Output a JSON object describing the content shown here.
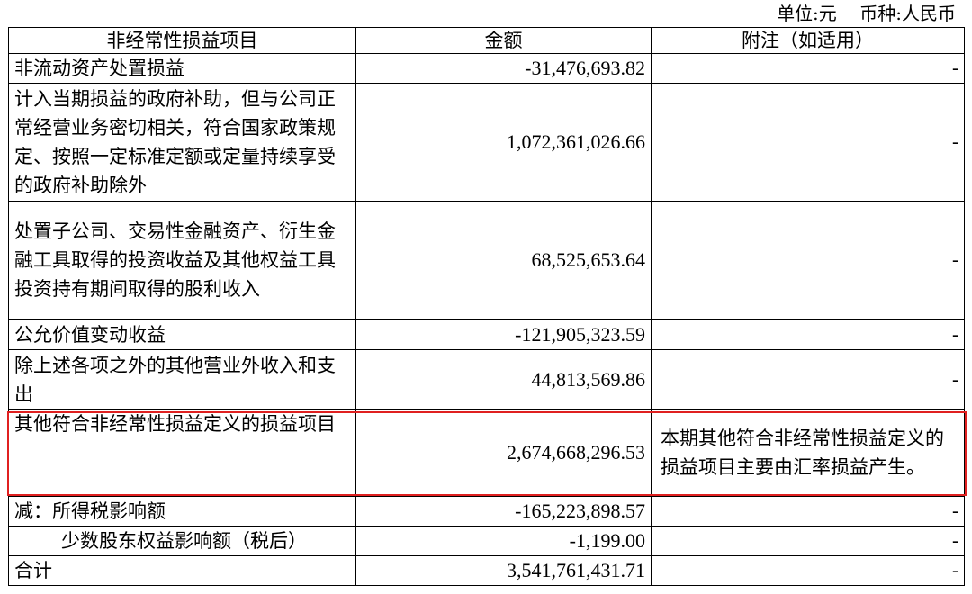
{
  "header": {
    "unit": "单位:元",
    "currency": "币种:人民币"
  },
  "table": {
    "columns": [
      "非经常性损益项目",
      "金额",
      "附注（如适用）"
    ],
    "rows": [
      {
        "item": "非流动资产处置损益",
        "amount": "-31,476,693.82",
        "note": "-"
      },
      {
        "item": "计入当期损益的政府补助，但与公司正常经营业务密切相关，符合国家政策规定、按照一定标准定额或定量持续享受的政府补助除外",
        "amount": "1,072,361,026.66",
        "note": "-"
      },
      {
        "item": "处置子公司、交易性金融资产、衍生金融工具取得的投资收益及其他权益工具投资持有期间取得的股利收入",
        "amount": "68,525,653.64",
        "note": "-"
      },
      {
        "item": "公允价值变动收益",
        "amount": "-121,905,323.59",
        "note": "-"
      },
      {
        "item": "除上述各项之外的其他营业外收入和支出",
        "amount": "44,813,569.86",
        "note": "-"
      },
      {
        "item": "其他符合非经常性损益定义的损益项目",
        "amount": "2,674,668,296.53",
        "note": "本期其他符合非经常性损益定义的损益项目主要由汇率损益产生。"
      },
      {
        "item": "减：所得税影响额",
        "amount": "-165,223,898.57",
        "note": "-"
      },
      {
        "item": "少数股东权益影响额（税后）",
        "amount": "-1,199.00",
        "note": "-"
      },
      {
        "item": "合计",
        "amount": "3,541,761,431.71",
        "note": "-"
      }
    ]
  },
  "colors": {
    "highlight": "#e02020",
    "border": "#000000"
  }
}
